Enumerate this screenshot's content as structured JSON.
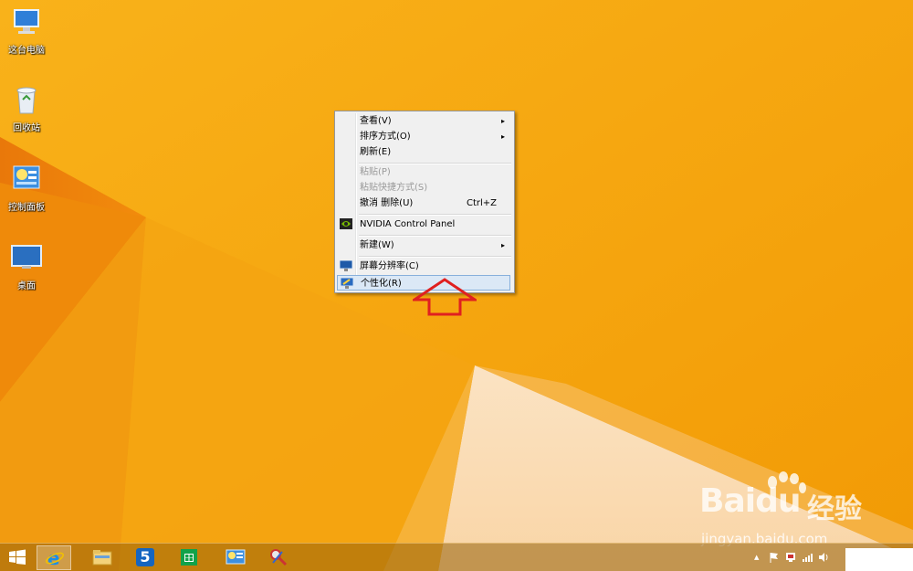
{
  "desktop": {
    "icons": [
      {
        "label": "这台电脑",
        "icon": "computer-icon"
      },
      {
        "label": "回收站",
        "icon": "recycle-bin-icon"
      },
      {
        "label": "控制面板",
        "icon": "control-panel-icon"
      },
      {
        "label": "桌面",
        "icon": "monitor-icon"
      }
    ]
  },
  "context_menu": {
    "items": [
      {
        "label": "查看(V)",
        "submenu": true,
        "enabled": true
      },
      {
        "label": "排序方式(O)",
        "submenu": true,
        "enabled": true
      },
      {
        "label": "刷新(E)",
        "enabled": true
      },
      {
        "label": "粘贴(P)",
        "enabled": false
      },
      {
        "label": "粘贴快捷方式(S)",
        "enabled": false
      },
      {
        "label": "撤消 删除(U)",
        "shortcut": "Ctrl+Z",
        "enabled": true
      },
      {
        "label": "NVIDIA Control Panel",
        "icon": "nvidia-icon",
        "enabled": true
      },
      {
        "label": "新建(W)",
        "submenu": true,
        "enabled": true
      },
      {
        "label": "屏幕分辨率(C)",
        "icon": "display-icon",
        "enabled": true
      },
      {
        "label": "个性化(R)",
        "icon": "personalize-icon",
        "enabled": true,
        "highlighted": true
      }
    ],
    "submenu_arrow": "▸"
  },
  "annotation": {
    "icon": "red-up-arrow-icon",
    "color": "#e02020"
  },
  "taskbar": {
    "buttons": [
      {
        "name": "start",
        "icon": "windows-logo-icon"
      },
      {
        "name": "internet-explorer",
        "icon": "ie-icon",
        "active": true
      },
      {
        "name": "file-explorer",
        "icon": "folder-icon"
      },
      {
        "name": "app-5",
        "icon": "five-app-icon",
        "glyph": "5"
      },
      {
        "name": "store",
        "icon": "store-icon"
      },
      {
        "name": "control-panel",
        "icon": "control-panel-icon"
      },
      {
        "name": "tools",
        "icon": "tools-icon"
      }
    ],
    "tray": {
      "chevron": "▲",
      "icons": [
        "flag-icon",
        "network-icon",
        "signal-icon",
        "volume-icon"
      ]
    }
  },
  "watermark": {
    "brand": "Bai",
    "brand_b": "du",
    "brand_cn": "经验",
    "url": "jingyan.baidu.com"
  },
  "colors": {
    "wallpaper": "#f6a90c",
    "menu_highlight": "#dbe8f6",
    "arrow": "#e02020"
  }
}
